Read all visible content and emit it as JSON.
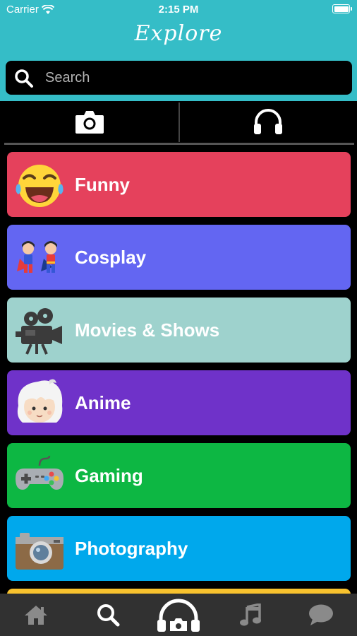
{
  "status_bar": {
    "carrier": "Carrier",
    "time": "2:15 PM"
  },
  "header": {
    "title": "Explore"
  },
  "search": {
    "placeholder": "Search"
  },
  "top_tabs": [
    {
      "icon": "camera-icon",
      "active": true
    },
    {
      "icon": "headphones-icon",
      "active": false
    }
  ],
  "categories": [
    {
      "label": "Funny",
      "icon": "laughing-emoji-icon",
      "color": "#E5415C"
    },
    {
      "label": "Cosplay",
      "icon": "superhero-couple-icon",
      "color": "#6366F2"
    },
    {
      "label": "Movies & Shows",
      "icon": "film-camera-icon",
      "color": "#9ED2CD"
    },
    {
      "label": "Anime",
      "icon": "anime-face-icon",
      "color": "#6F32C9"
    },
    {
      "label": "Gaming",
      "icon": "game-controller-icon",
      "color": "#0DB743"
    },
    {
      "label": "Photography",
      "icon": "photo-camera-icon",
      "color": "#00A8EC"
    },
    {
      "label": "",
      "icon": "",
      "color": "#F8C22E"
    }
  ],
  "bottom_tabs": [
    {
      "icon": "home-icon",
      "active": false
    },
    {
      "icon": "search-icon",
      "active": true
    },
    {
      "icon": "headphones-camera-icon",
      "active": false
    },
    {
      "icon": "music-note-icon",
      "active": false
    },
    {
      "icon": "chat-bubble-icon",
      "active": false
    }
  ],
  "colors": {
    "header_bg": "#35BDC7",
    "background": "#000000",
    "tabbar_bg": "#313131"
  }
}
